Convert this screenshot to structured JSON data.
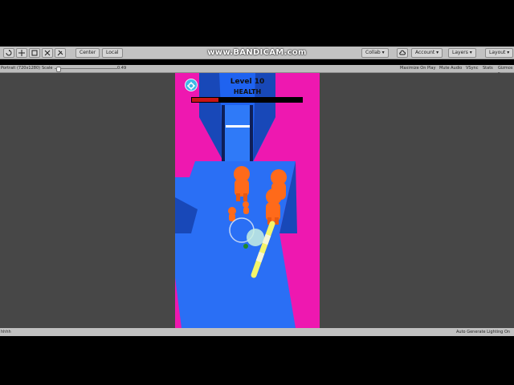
{
  "editor": {
    "toolbar": {
      "pivot_label": "Center",
      "space_label": "Local",
      "collab_label": "Collab ▾",
      "account_label": "Account ▾",
      "layers_label": "Layers ▾",
      "layout_label": "Layout ▾"
    },
    "game_view": {
      "resolution_label": "Portrait (720x1280)",
      "scale_label": "Scale",
      "scale_value": "0.49",
      "maximize_label": "Maximize On Play",
      "mute_label": "Mute Audio",
      "vsync_label": "VSync",
      "stats_label": "Stats",
      "gizmos_label": "Gizmos ▾"
    },
    "status": {
      "left_text": "hhhh",
      "right_text": "Auto Generate Lighting On"
    }
  },
  "watermark": "www.BANDICAM.com",
  "game": {
    "level_label": "Level 10",
    "health_label": "HEALTH",
    "health_fraction": 0.24,
    "colors": {
      "background": "#ee18b0",
      "track": "#1f63f0",
      "runner": "#ff6a1a",
      "pole": "#f4f46a",
      "settings": "#3fb8e6"
    }
  }
}
